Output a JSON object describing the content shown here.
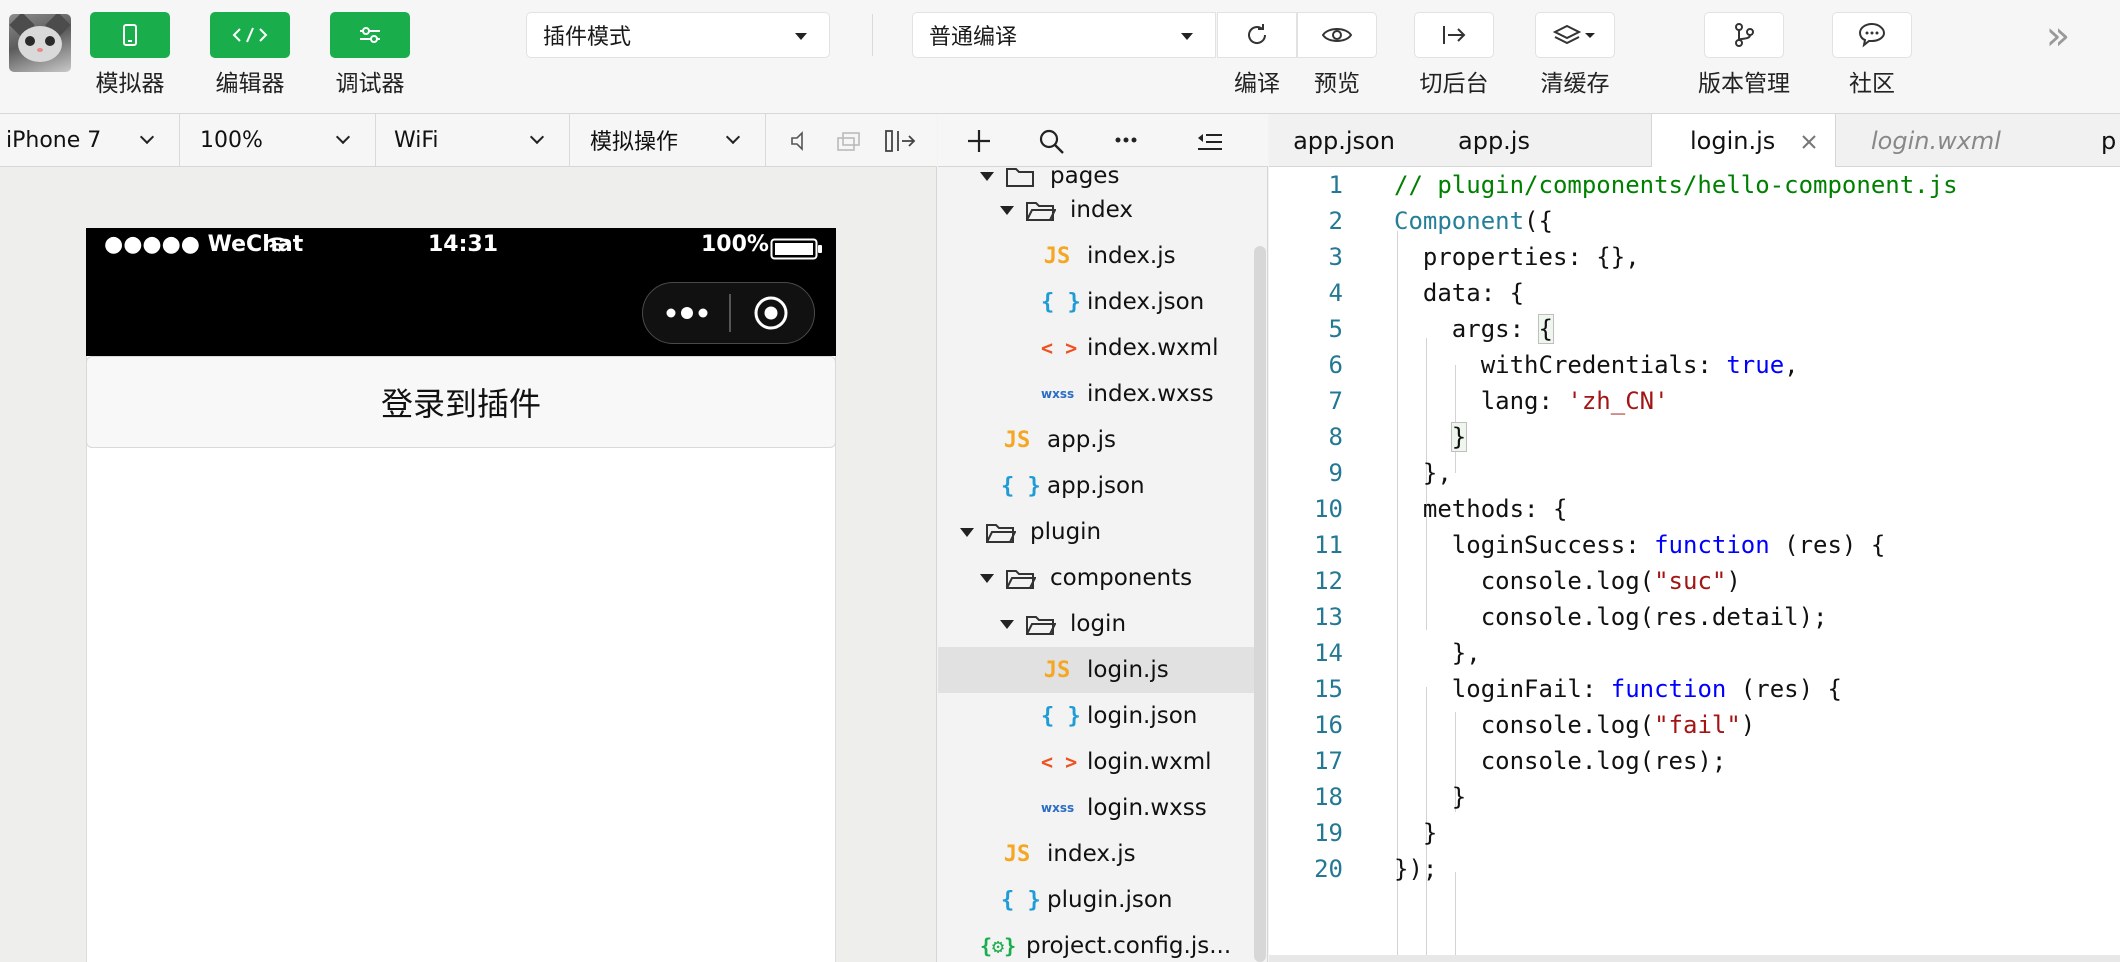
{
  "toolbar": {
    "simulator_label": "模拟器",
    "editor_label": "编辑器",
    "debugger_label": "调试器",
    "mode_select": "插件模式",
    "compile_select": "普通编译",
    "compile_label": "编译",
    "preview_label": "预览",
    "background_label": "切后台",
    "clear_cache_label": "清缓存",
    "version_label": "版本管理",
    "community_label": "社区",
    "more_label": "»"
  },
  "simbar": {
    "device": "iPhone 7",
    "zoom": "100%",
    "network": "WiFi",
    "operation": "模拟操作"
  },
  "phone": {
    "carrier": "●●●●● WeChat",
    "time": "14:31",
    "battery": "100%",
    "button_label": "登录到插件"
  },
  "tree": {
    "items": [
      {
        "label": "pages",
        "type": "folder"
      },
      {
        "label": "index",
        "type": "folder"
      },
      {
        "label": "index.js",
        "type": "js"
      },
      {
        "label": "index.json",
        "type": "json"
      },
      {
        "label": "index.wxml",
        "type": "wxml"
      },
      {
        "label": "index.wxss",
        "type": "wxss"
      },
      {
        "label": "app.js",
        "type": "js"
      },
      {
        "label": "app.json",
        "type": "json"
      },
      {
        "label": "plugin",
        "type": "folder"
      },
      {
        "label": "components",
        "type": "folder"
      },
      {
        "label": "login",
        "type": "folder"
      },
      {
        "label": "login.js",
        "type": "js"
      },
      {
        "label": "login.json",
        "type": "json"
      },
      {
        "label": "login.wxml",
        "type": "wxml"
      },
      {
        "label": "login.wxss",
        "type": "wxss"
      },
      {
        "label": "index.js",
        "type": "js"
      },
      {
        "label": "plugin.json",
        "type": "json"
      },
      {
        "label": "project.config.js...",
        "type": "config"
      }
    ],
    "icon_labels": {
      "js": "JS",
      "json": "{ }",
      "wxml": "< >",
      "wxss": "wxss",
      "config": "{⚙}"
    }
  },
  "tabs": [
    {
      "label": "app.json"
    },
    {
      "label": "app.js"
    },
    {
      "label": "login.js"
    },
    {
      "label": "login.wxml"
    },
    {
      "label": "p"
    }
  ],
  "editor": {
    "line_numbers": [
      "1",
      "2",
      "3",
      "4",
      "5",
      "6",
      "7",
      "8",
      "9",
      "10",
      "11",
      "12",
      "13",
      "14",
      "15",
      "16",
      "17",
      "18",
      "19",
      "20"
    ]
  }
}
